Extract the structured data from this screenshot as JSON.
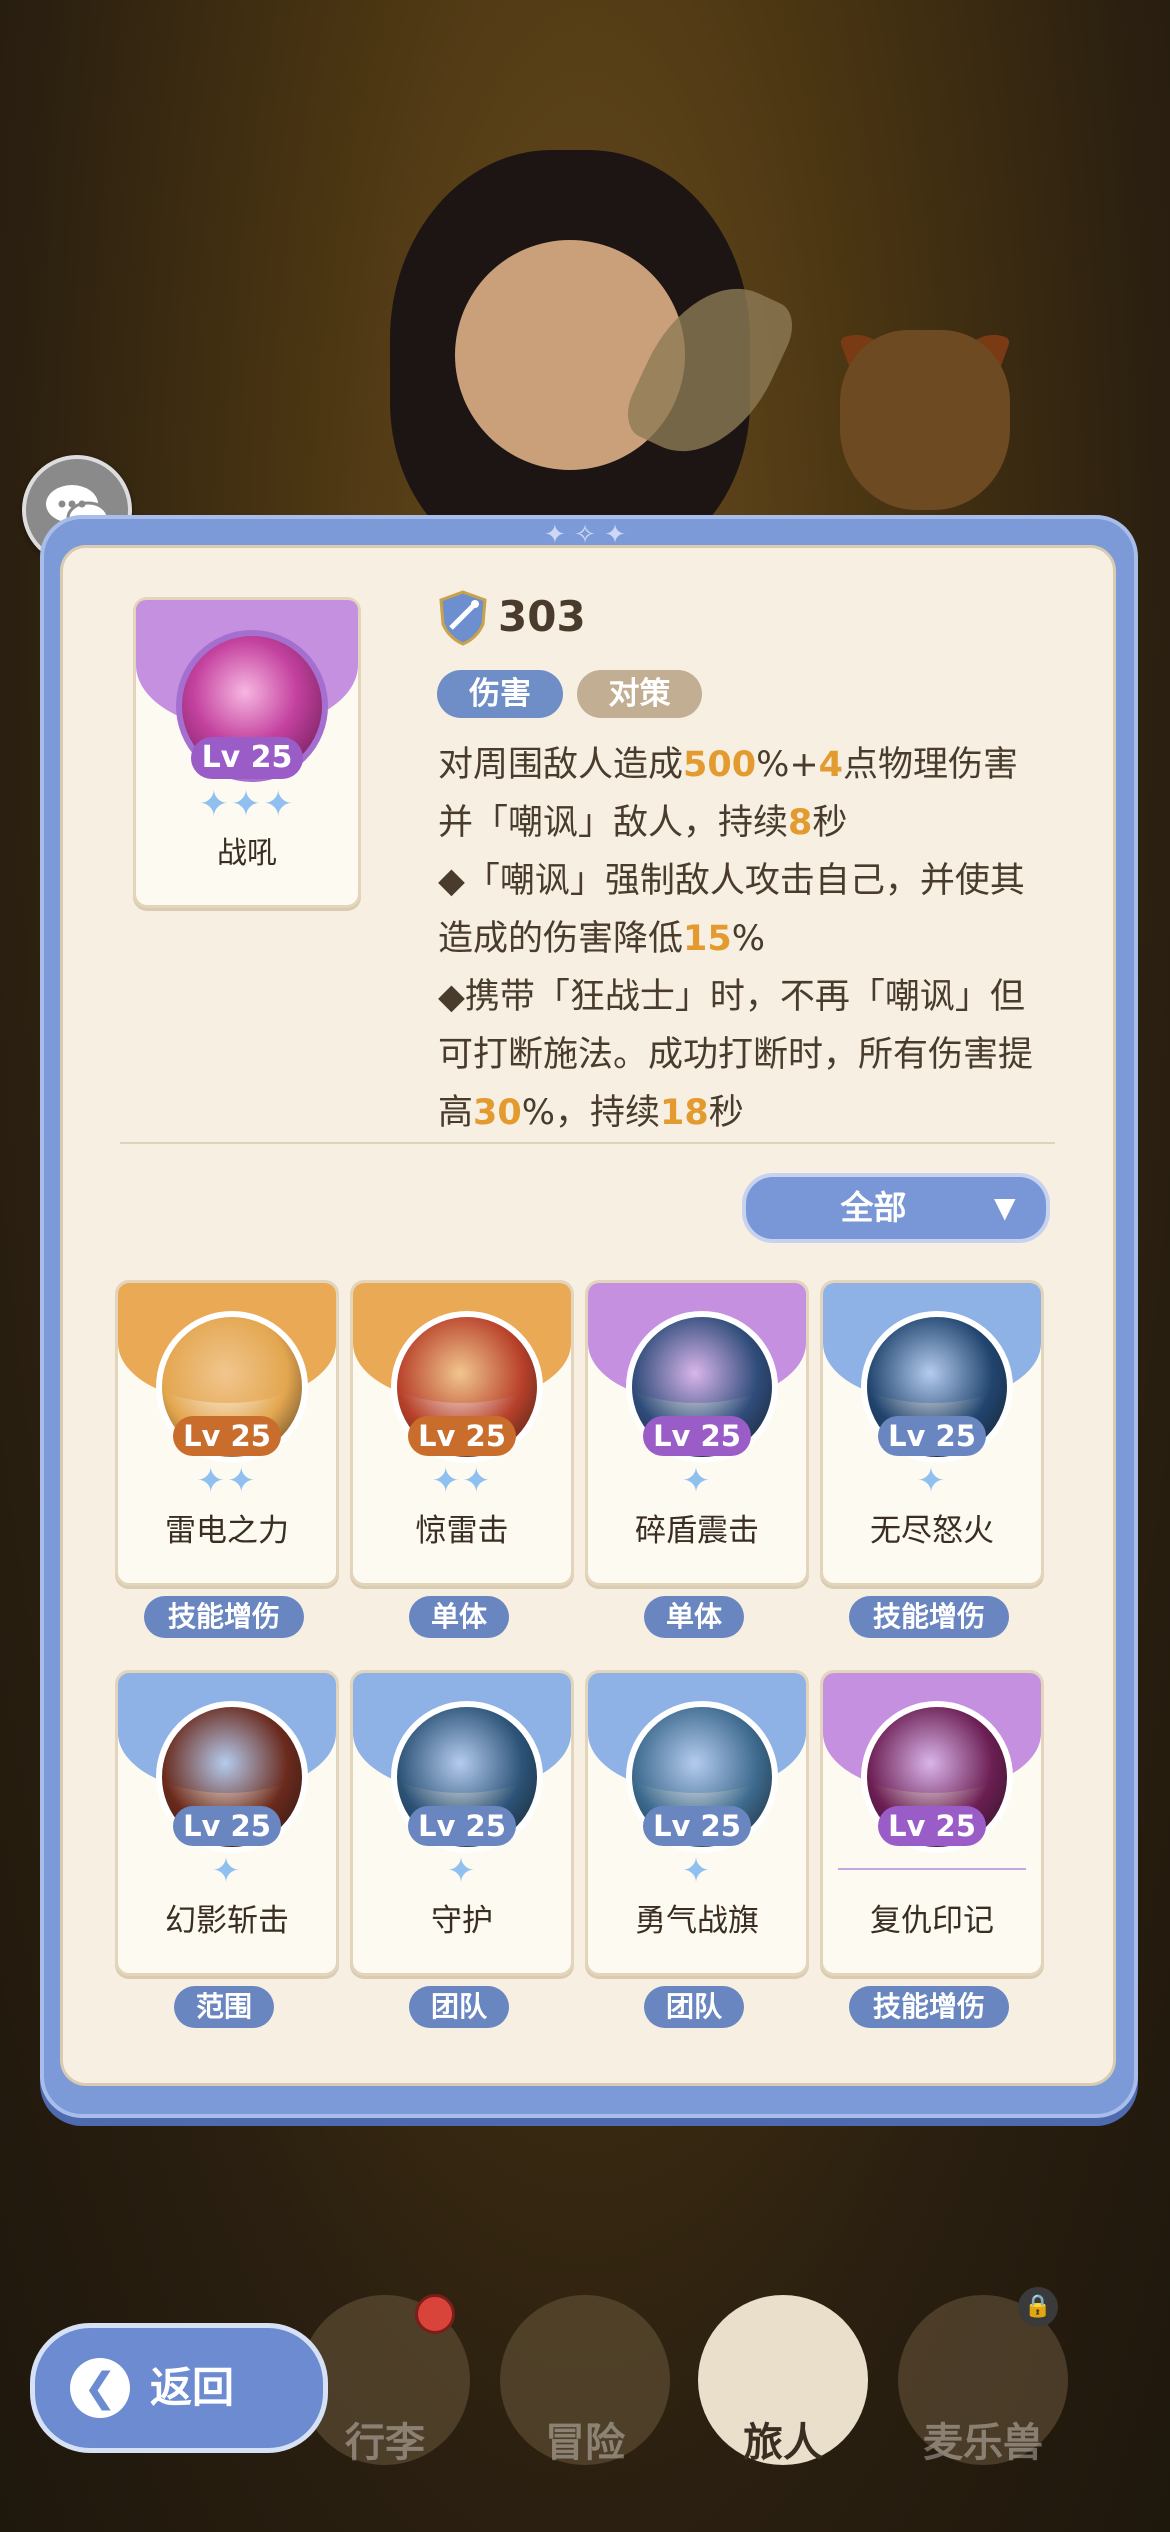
{
  "skill": {
    "name": "战吼",
    "level": "Lv 25",
    "stars": "✦✦✦",
    "power": "303",
    "tags": [
      "伤害",
      "对策"
    ],
    "desc": [
      {
        "text": "对周围敌人造成",
        "hl": false
      },
      {
        "text": "500",
        "hl": true
      },
      {
        "text": "%+",
        "hl": false
      },
      {
        "text": "4",
        "hl": true
      },
      {
        "text": "点物理伤害并「嘲讽」敌人，持续",
        "hl": false
      },
      {
        "text": "8",
        "hl": true
      },
      {
        "text": "秒",
        "hl": false
      },
      {
        "text": "\n◆「嘲讽」强制敌人攻击自己，并使其造成的伤害降低",
        "hl": false
      },
      {
        "text": "15",
        "hl": true
      },
      {
        "text": "%",
        "hl": false
      },
      {
        "text": "\n◆携带「狂战士」时，不再「嘲讽」但可打断施法。成功打断时，所有伤害提高",
        "hl": false
      },
      {
        "text": "30",
        "hl": true
      },
      {
        "text": "%，持续",
        "hl": false
      },
      {
        "text": "18",
        "hl": true
      },
      {
        "text": "秒",
        "hl": false
      }
    ]
  },
  "filter": {
    "label": "全部",
    "arrow": "▼"
  },
  "cards": [
    {
      "name": "雷电之力",
      "level": "Lv 25",
      "stars": "✦✦",
      "badge": "技能增伤",
      "band": "#e9a955",
      "orb": "#e3a64f",
      "lvbg": "#c96d2c"
    },
    {
      "name": "惊雷击",
      "level": "Lv 25",
      "stars": "✦✦",
      "badge": "单体",
      "band": "#e9a955",
      "orb": "#b8412a",
      "lvbg": "#c96d2c"
    },
    {
      "name": "碎盾震击",
      "level": "Lv 25",
      "stars": "✦",
      "badge": "单体",
      "band": "#c690e0",
      "orb": "#2f4c7a",
      "lvbg": "#9a5cc7"
    },
    {
      "name": "无尽怒火",
      "level": "Lv 25",
      "stars": "✦",
      "badge": "技能增伤",
      "band": "#8fb2e6",
      "orb": "#21456f",
      "lvbg": "#6a86c0"
    },
    {
      "name": "幻影斩击",
      "level": "Lv 25",
      "stars": "✦",
      "badge": "范围",
      "band": "#8fb2e6",
      "orb": "#6a2a1c",
      "lvbg": "#6a86c0"
    },
    {
      "name": "守护",
      "level": "Lv 25",
      "stars": "✦",
      "badge": "团队",
      "band": "#8fb2e6",
      "orb": "#2c5377",
      "lvbg": "#6a86c0"
    },
    {
      "name": "勇气战旗",
      "level": "Lv 25",
      "stars": "✦",
      "badge": "团队",
      "band": "#8fb2e6",
      "orb": "#3d6a8e",
      "lvbg": "#6a86c0"
    },
    {
      "name": "复仇印记",
      "level": "Lv 25",
      "stars": "",
      "badge": "技能增伤",
      "band": "#c690e0",
      "orb": "#6b1e52",
      "lvbg": "#9a5cc7"
    }
  ],
  "nav": {
    "back": "返回",
    "items": [
      "行李",
      "冒险",
      "旅人",
      "麦乐兽"
    ],
    "active": "旅人"
  },
  "colors": {
    "accent": "#7996d6",
    "highlight": "#e39a2e"
  }
}
